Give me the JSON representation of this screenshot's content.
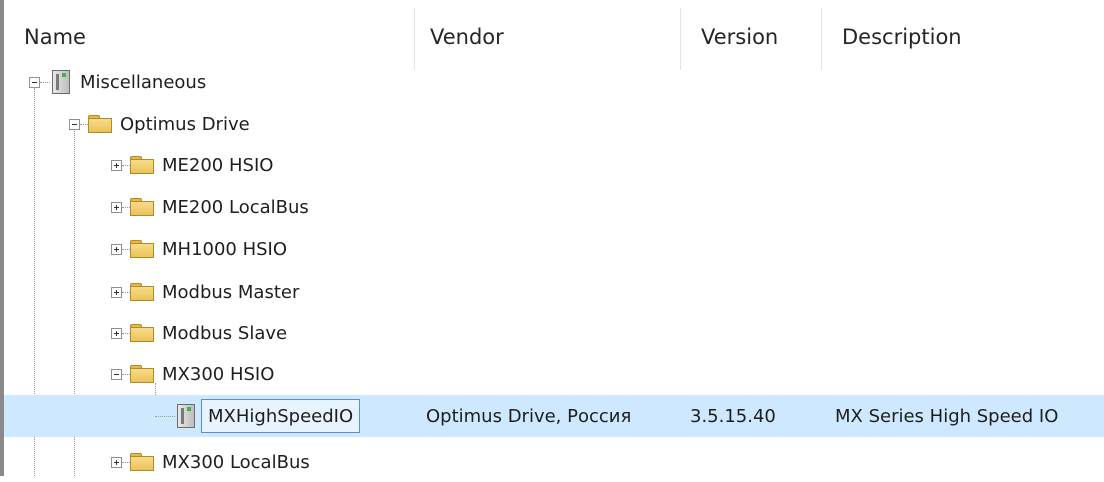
{
  "columns": {
    "name": "Name",
    "vendor": "Vendor",
    "version": "Version",
    "description": "Description"
  },
  "tree": [
    {
      "label": "Miscellaneous",
      "icon": "device-icon",
      "level": 0,
      "expander": "minus"
    },
    {
      "label": "Optimus Drive",
      "icon": "folder-icon",
      "level": 1,
      "expander": "minus"
    },
    {
      "label": "ME200 HSIO",
      "icon": "folder-icon",
      "level": 2,
      "expander": "plus"
    },
    {
      "label": "ME200 LocalBus",
      "icon": "folder-icon",
      "level": 2,
      "expander": "plus"
    },
    {
      "label": "MH1000 HSIO",
      "icon": "folder-icon",
      "level": 2,
      "expander": "plus"
    },
    {
      "label": "Modbus Master",
      "icon": "folder-icon",
      "level": 2,
      "expander": "plus"
    },
    {
      "label": "Modbus Slave",
      "icon": "folder-icon",
      "level": 2,
      "expander": "plus"
    },
    {
      "label": "MX300 HSIO",
      "icon": "folder-icon",
      "level": 2,
      "expander": "minus"
    },
    {
      "label": "MXHighSpeedIO",
      "icon": "device-icon",
      "level": 3,
      "expander": "none",
      "selected": true,
      "vendor": "Optimus Drive, Россия",
      "version": "3.5.15.40",
      "description": "MX Series High Speed IO"
    },
    {
      "label": "MX300 LocalBus",
      "icon": "folder-icon",
      "level": 2,
      "expander": "plus"
    }
  ],
  "colors": {
    "selection": "#cde8ff",
    "edit_border": "#5a8fd0",
    "folder": "#f0cc6a"
  }
}
